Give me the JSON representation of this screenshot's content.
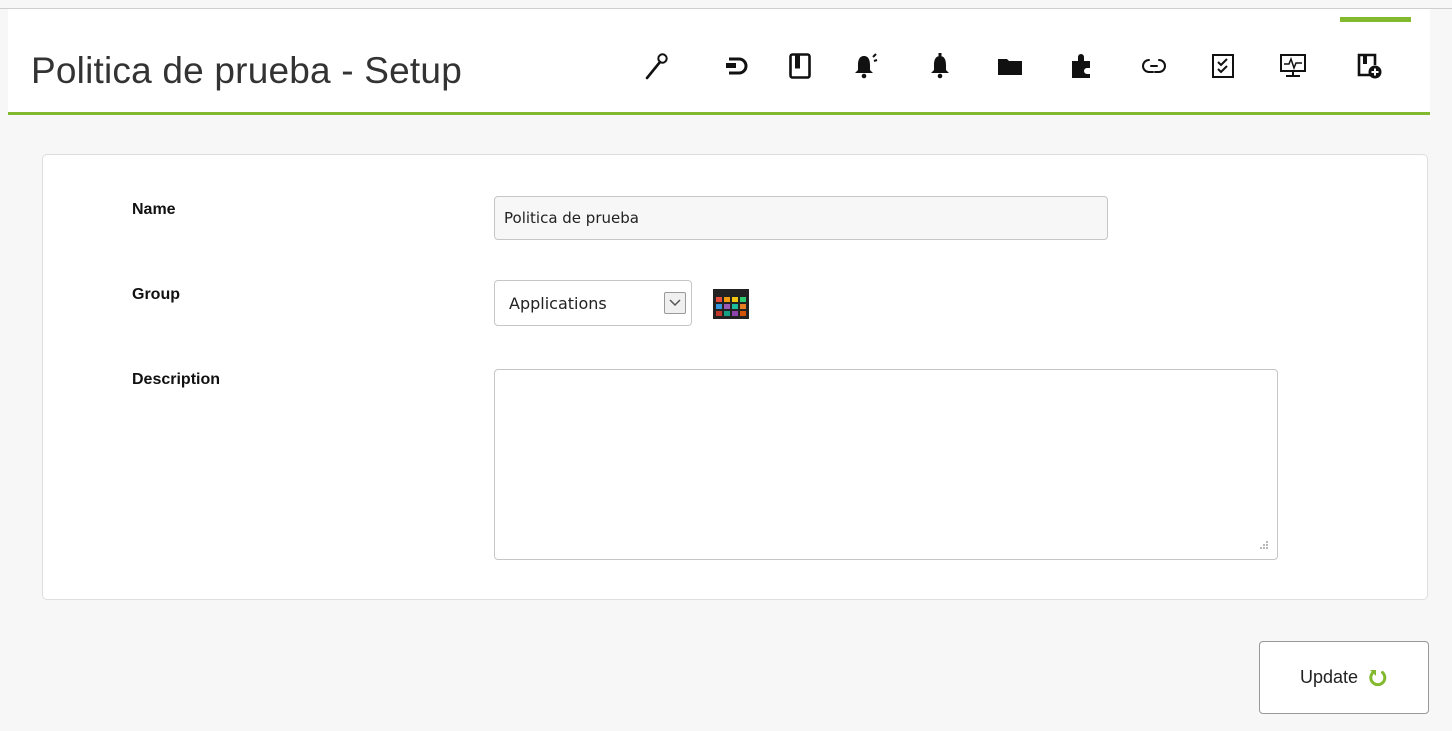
{
  "header": {
    "title": "Politica de prueba - Setup",
    "accent_color": "#82b92e",
    "tabs": [
      {
        "icon": "wrench-icon"
      },
      {
        "icon": "plug-icon"
      },
      {
        "icon": "agents-icon"
      },
      {
        "icon": "alert-templates-icon"
      },
      {
        "icon": "alerts-bell-icon"
      },
      {
        "icon": "folder-icon"
      },
      {
        "icon": "plugins-icon"
      },
      {
        "icon": "links-icon"
      },
      {
        "icon": "inventory-checklist-icon"
      },
      {
        "icon": "monitor-icon"
      },
      {
        "icon": "queue-add-icon",
        "active": true
      }
    ]
  },
  "form": {
    "name": {
      "label": "Name",
      "value": "Politica de prueba"
    },
    "group": {
      "label": "Group",
      "value": "Applications",
      "icon": "palette-icon"
    },
    "description": {
      "label": "Description",
      "value": ""
    }
  },
  "actions": {
    "update_label": "Update",
    "update_icon": "refresh-icon"
  }
}
